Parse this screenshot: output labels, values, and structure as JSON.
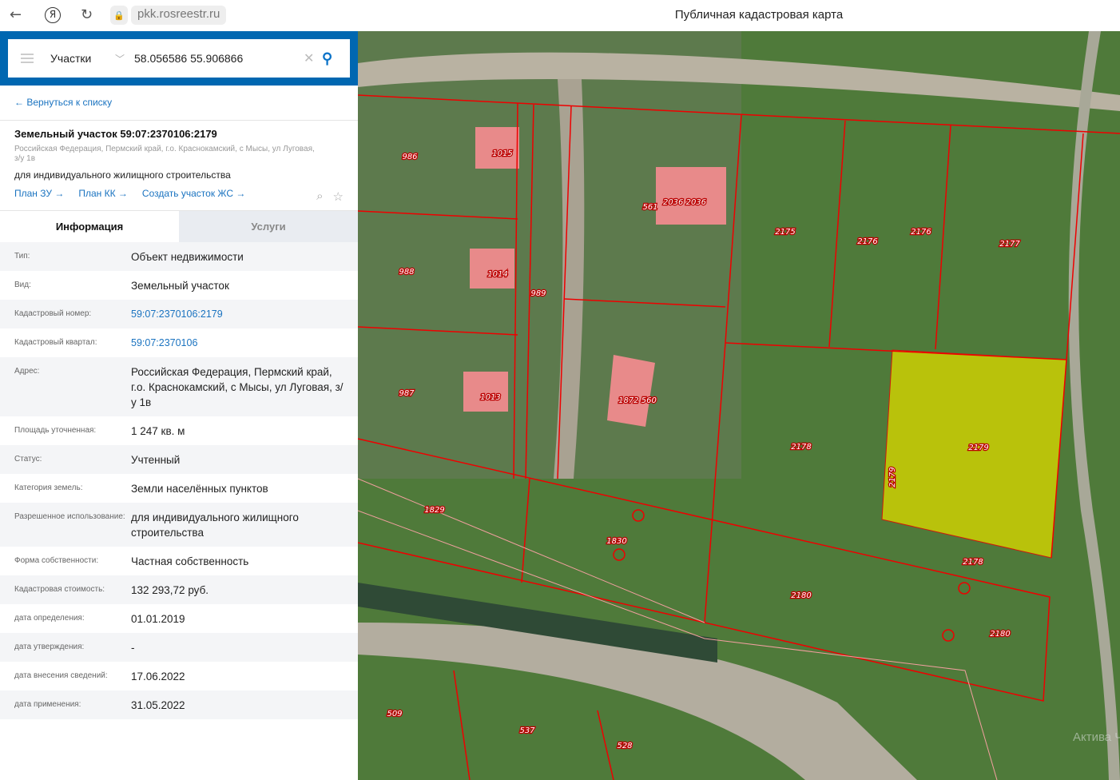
{
  "browser": {
    "url": "pkk.rosreestr.ru",
    "page_title": "Публичная кадастровая карта"
  },
  "search": {
    "layer": "Участки",
    "query": "58.056586 55.906866"
  },
  "back_link": "← Вернуться к списку",
  "object": {
    "title": "Земельный участок 59:07:2370106:2179",
    "address": "Российская Федерация, Пермский край, г.о. Краснокамский, с Мысы, ул Луговая, з/у 1в",
    "purpose": "для индивидуального жилищного строительства",
    "links": [
      "План ЗУ →",
      "План КК →",
      "Создать участок ЖС →"
    ]
  },
  "tabs": [
    {
      "label": "Информация",
      "active": true
    },
    {
      "label": "Услуги",
      "active": false
    }
  ],
  "info": [
    {
      "label": "Тип:",
      "value": "Объект недвижимости"
    },
    {
      "label": "Вид:",
      "value": "Земельный участок"
    },
    {
      "label": "Кадастровый номер:",
      "value": "59:07:2370106:2179",
      "link": true
    },
    {
      "label": "Кадастровый квартал:",
      "value": "59:07:2370106",
      "link": true
    },
    {
      "label": "Адрес:",
      "value": "Российская Федерация, Пермский край, г.о. Краснокамский, с Мысы, ул Луговая, з/у 1в"
    },
    {
      "label": "Площадь уточненная:",
      "value": "1 247 кв. м"
    },
    {
      "label": "Статус:",
      "value": "Учтенный"
    },
    {
      "label": "Категория земель:",
      "value": "Земли населённых пунктов"
    },
    {
      "label": "Разрешенное использование:",
      "value": "для индивидуального жилищного строительства"
    },
    {
      "label": "Форма собственности:",
      "value": "Частная собственность"
    },
    {
      "label": "Кадастровая стоимость:",
      "value": "132 293,72 руб."
    },
    {
      "label": "дата определения:",
      "value": "01.01.2019"
    },
    {
      "label": "дата утверждения:",
      "value": "-"
    },
    {
      "label": "дата внесения сведений:",
      "value": "17.06.2022"
    },
    {
      "label": "дата применения:",
      "value": "31.05.2022"
    }
  ],
  "map": {
    "parcel_labels": [
      "986",
      "1015",
      "2036 2036",
      "561",
      "2175",
      "2176",
      "2176",
      "2177",
      "988",
      "1014",
      "989",
      "987",
      "1013",
      "1872 560",
      "2178",
      "2179",
      "2179",
      "1829",
      "1830",
      "2178",
      "2180",
      "2180",
      "509",
      "537",
      "528"
    ],
    "watermark": "Актива Чтобы ак",
    "colors": {
      "selected": "#d4d400",
      "boundary": "#e00000",
      "building": "#e88a8a"
    }
  }
}
